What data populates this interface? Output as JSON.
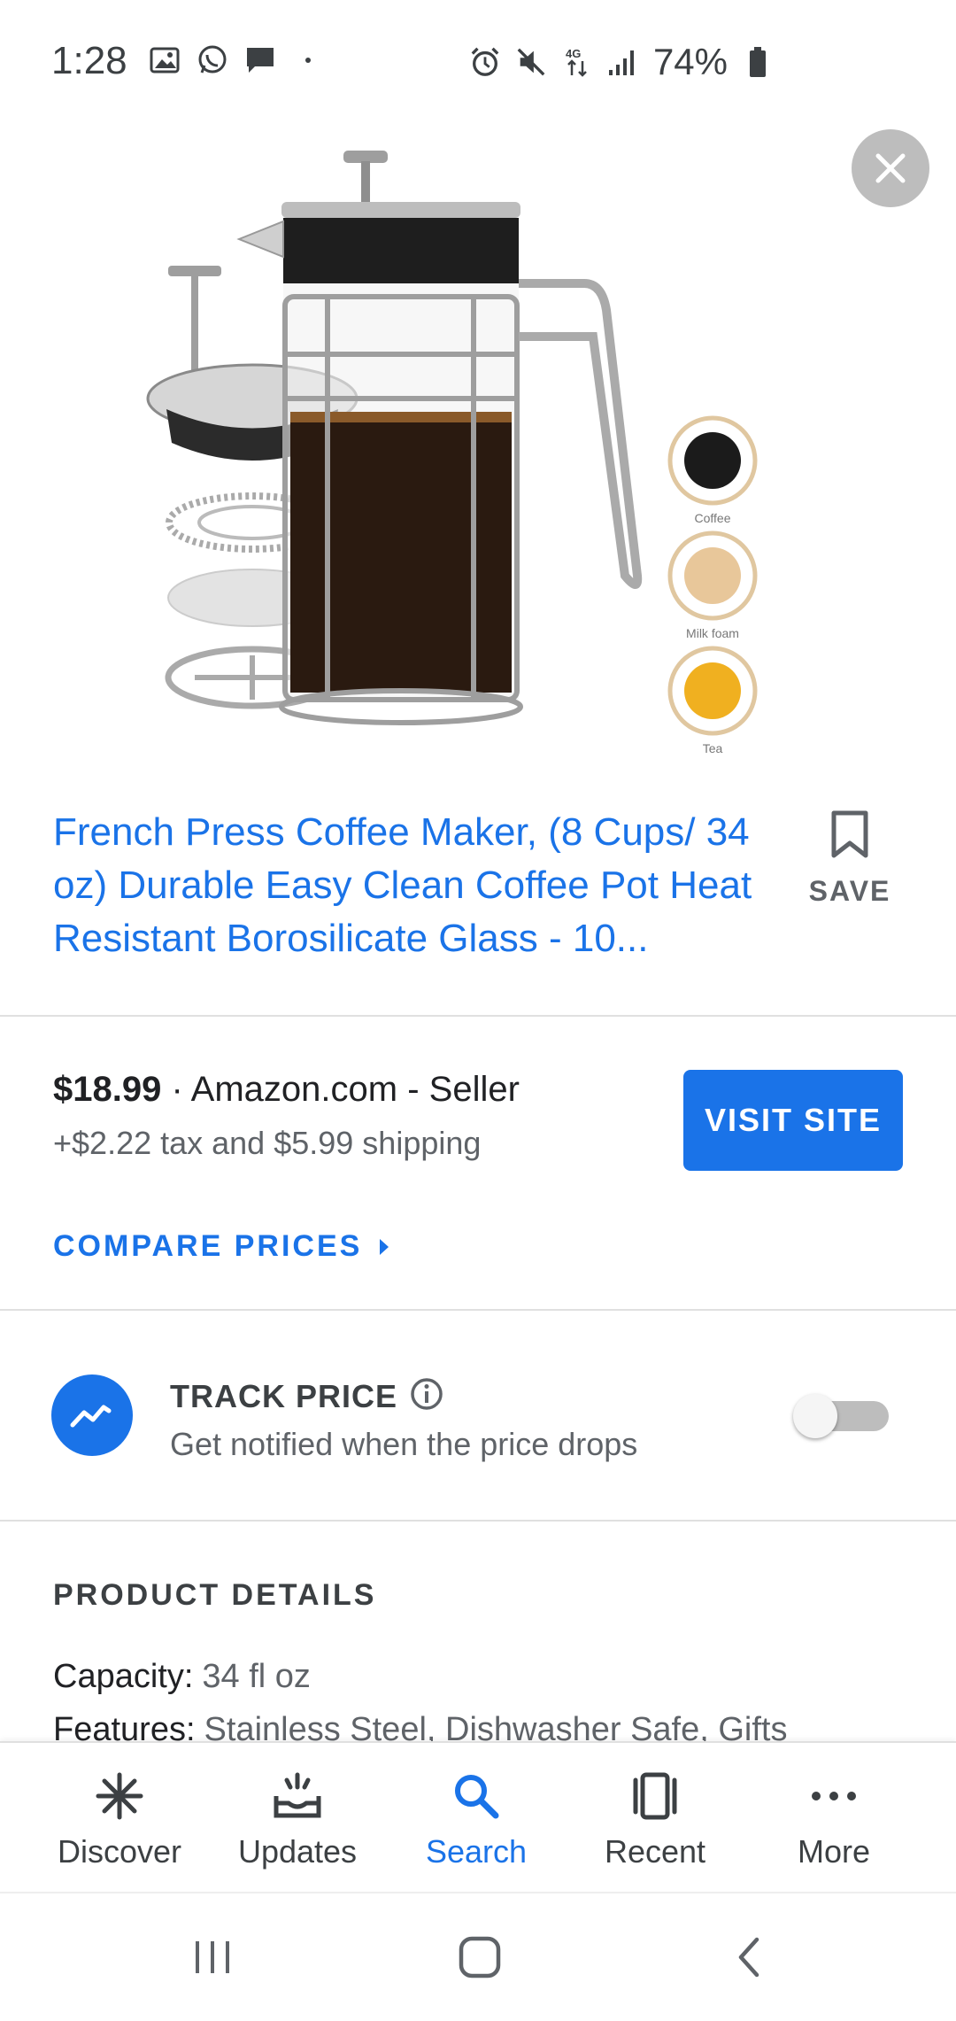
{
  "status_bar": {
    "time": "1:28",
    "battery": "74%"
  },
  "product": {
    "title": "French Press Coffee Maker, (8 Cups/ 34 oz) Durable Easy Clean Coffee Pot Heat Resistant Borosilicate Glass - 10...",
    "image_labels": {
      "coffee": "Coffee",
      "milk_foam": "Milk foam",
      "tea": "Tea"
    }
  },
  "save": {
    "label": "SAVE"
  },
  "price": {
    "amount": "$18.99",
    "seller": " · Amazon.com - Seller",
    "extra": "+$2.22 tax and $5.99 shipping",
    "visit_label": "VISIT SITE",
    "compare_label": "COMPARE PRICES"
  },
  "track": {
    "title": "TRACK PRICE",
    "subtitle": "Get notified when the price drops",
    "enabled": false
  },
  "details": {
    "heading": "PRODUCT DETAILS",
    "rows": [
      {
        "label": "Capacity:",
        "value": "34 fl oz"
      },
      {
        "label": "Features:",
        "value": "Stainless Steel, Dishwasher Safe, Gifts"
      }
    ]
  },
  "bottom_nav": {
    "items": [
      {
        "label": "Discover",
        "icon": "asterisk-icon"
      },
      {
        "label": "Updates",
        "icon": "updates-tray-icon"
      },
      {
        "label": "Search",
        "icon": "search-icon",
        "active": true
      },
      {
        "label": "Recent",
        "icon": "recent-cards-icon"
      },
      {
        "label": "More",
        "icon": "more-dots-icon"
      }
    ]
  },
  "colors": {
    "accent": "#1a73e8",
    "text": "#202124",
    "muted": "#5f6368"
  }
}
